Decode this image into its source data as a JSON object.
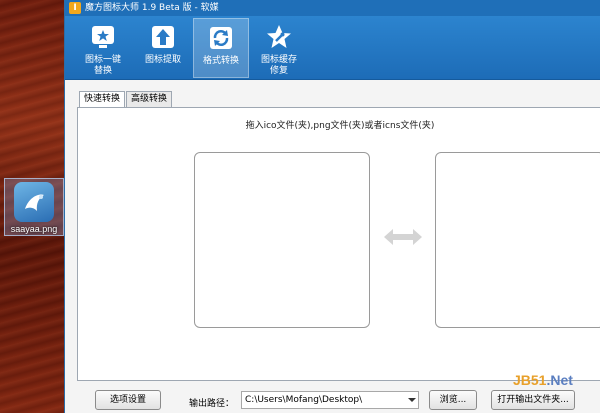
{
  "desktop": {
    "icon_label": "saayaa.png",
    "icon_name": "png-file-icon"
  },
  "window": {
    "title": "魔方图标大师 1.9 Beta 版 - 软媒",
    "logo_glyph": "I"
  },
  "toolbar": {
    "items": [
      {
        "label": "图标一键\n替换",
        "icon": "monitor-star-icon",
        "active": false
      },
      {
        "label": "图标提取",
        "icon": "upload-arrow-icon",
        "active": false
      },
      {
        "label": "格式转换",
        "icon": "refresh-icon",
        "active": true
      },
      {
        "label": "图标缓存\n修复",
        "icon": "star-wrench-icon",
        "active": false
      }
    ]
  },
  "tabs": [
    {
      "label": "快速转换",
      "active": true
    },
    {
      "label": "高级转换",
      "active": false
    }
  ],
  "panel": {
    "hint": "拖入ico文件(夹),png文件(夹)或者icns文件(夹)",
    "swap_icon": "double-arrow-icon"
  },
  "bottom": {
    "options_button": "选项设置",
    "output_label": "输出路径：",
    "output_path": "C:\\Users\\Mofang\\Desktop\\",
    "browse_button": "浏览...",
    "open_folder_button": "打开输出文件夹..."
  },
  "watermark": {
    "part1": "JB51",
    "part2": ".Net"
  },
  "colors": {
    "toolbar": "#1f6fb8",
    "accent": "#2c84cf"
  }
}
